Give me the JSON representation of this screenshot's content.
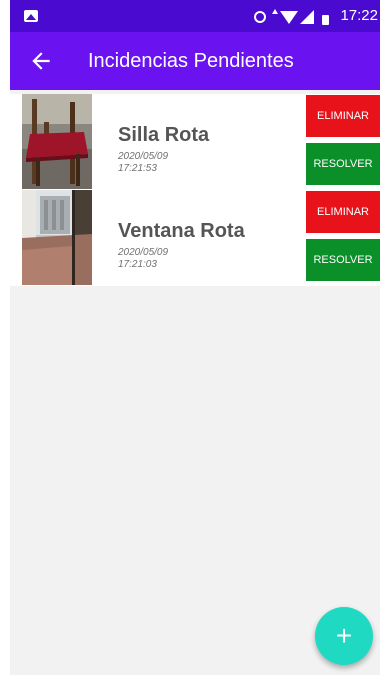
{
  "status_bar": {
    "time": "17:22",
    "icons": [
      "image-icon",
      "alarm-icon",
      "data-arrow-icon",
      "wifi-icon",
      "signal-icon",
      "battery-icon"
    ]
  },
  "app_bar": {
    "back_icon": "arrow-left-icon",
    "title": "Incidencias Pendientes"
  },
  "incidents": [
    {
      "title": "Silla Rota",
      "date": "2020/05/09",
      "time": "17:21:53",
      "delete_label": "ELIMINAR",
      "resolve_label": "RESOLVER"
    },
    {
      "title": "Ventana Rota",
      "date": "2020/05/09",
      "time": "17:21:03",
      "delete_label": "ELIMINAR",
      "resolve_label": "RESOLVER"
    }
  ],
  "fab": {
    "icon": "plus-icon",
    "glyph": "+"
  },
  "colors": {
    "status_bar": "#4a0ad0",
    "app_bar": "#6a12f0",
    "delete": "#e8121a",
    "resolve": "#0b8f28",
    "fab": "#1fd9c2"
  }
}
